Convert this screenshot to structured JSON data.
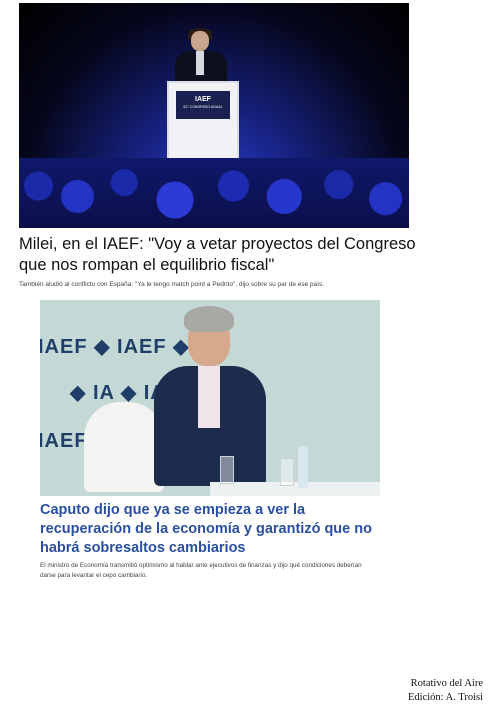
{
  "story1": {
    "podium_logo": "IAEF",
    "podium_sub": "51° CONGRESO ANUAL",
    "headline": "Milei, en el IAEF: \"Voy a vetar proyectos del Congreso que nos rompan el equilibrio fiscal\"",
    "lead": "También aludió al conflicto con España: \"Ya le tengo match point a Pedrito\", dijo sobre su par de ese país."
  },
  "story2": {
    "wall_rows": [
      "IAEF  ◆ IAEF  ◆ IA",
      "◆ IA  ◆ IAEF",
      "IAEF  ◆ IA"
    ],
    "headline": "Caputo dijo que ya se empieza a ver la recuperación de la economía y garantizó que no habrá sobresaltos cambiarios",
    "lead": "El ministro de Economía transmitió optimismo al hablar ante ejecutivos de finanzas y dijo qué condiciones deberían darse para levantar el cepo cambiario."
  },
  "credit": {
    "line1": "Rotativo del Aire",
    "line2": "Edición: A. Troisi"
  }
}
